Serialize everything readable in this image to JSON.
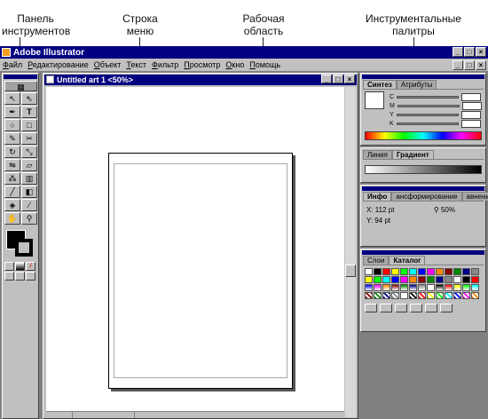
{
  "callouts": {
    "toolbox": [
      "Панель",
      "инструментов"
    ],
    "menubar": [
      "Строка",
      "меню"
    ],
    "workarea": [
      "Рабочая",
      "область"
    ],
    "palettes": [
      "Инструментальные",
      "палитры"
    ]
  },
  "app": {
    "title": "Adobe Illustrator",
    "menu": [
      "Файл",
      "Редактирование",
      "Объект",
      "Текст",
      "Фильтр",
      "Просмотр",
      "Окно",
      "Помощь"
    ]
  },
  "document": {
    "title": "Untitled art 1 <50%>"
  },
  "color_panel": {
    "tabs": [
      "Синтез",
      "Атрибуты"
    ],
    "channels": [
      "C",
      "M",
      "Y",
      "K"
    ]
  },
  "gradient_panel": {
    "tabs": [
      "Линия",
      "Градиент"
    ]
  },
  "info_panel": {
    "tabs": [
      "Инфо",
      "ансформирование",
      "авнение"
    ],
    "x": "X:  112 pt",
    "y": "Y:  94 pt",
    "zoom": "50%"
  },
  "swatch_panel": {
    "tabs": [
      "Слои",
      "Каталог"
    ]
  },
  "colors": {
    "titlebar": "#000080",
    "chrome": "#c0c0c0"
  }
}
